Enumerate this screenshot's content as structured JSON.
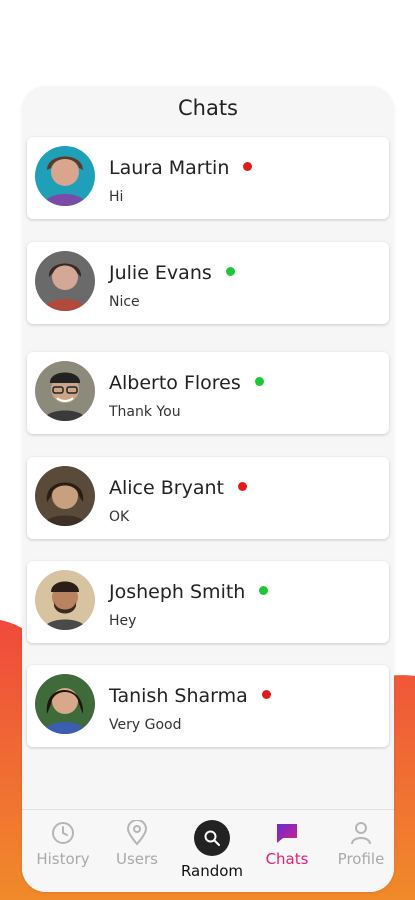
{
  "screen": {
    "title": "Chats"
  },
  "chats": [
    {
      "name": "Laura Martin",
      "message": "Hi",
      "status": "offline",
      "avatar": "avatar-laura"
    },
    {
      "name": "Julie Evans",
      "message": "Nice",
      "status": "online",
      "avatar": "avatar-julie"
    },
    {
      "name": "Alberto Flores",
      "message": "Thank You",
      "status": "online",
      "avatar": "avatar-alberto"
    },
    {
      "name": "Alice Bryant",
      "message": "OK",
      "status": "offline",
      "avatar": "avatar-alice"
    },
    {
      "name": "Josheph Smith",
      "message": "Hey",
      "status": "online",
      "avatar": "avatar-josheph"
    },
    {
      "name": "Tanish Sharma",
      "message": "Very Good",
      "status": "offline",
      "avatar": "avatar-tanish"
    }
  ],
  "nav": {
    "history": "History",
    "users": "Users",
    "random": "Random",
    "chats": "Chats",
    "profile": "Profile",
    "active": "chats"
  },
  "colors": {
    "online": "#1ec832",
    "offline": "#e01b1b",
    "accent": "#e0207a",
    "wave_top": "#f0593a",
    "wave_bottom": "#f07a2a"
  },
  "icons": {
    "history": "history-clock-icon",
    "users": "map-pin-icon",
    "random": "search-icon",
    "chats": "chat-bubble-icon",
    "profile": "person-icon"
  }
}
